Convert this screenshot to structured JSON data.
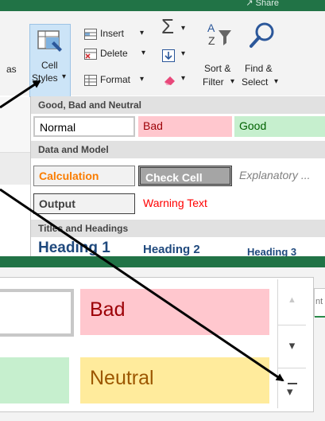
{
  "title_bar": {
    "share_text": "↗ Share"
  },
  "ribbon": {
    "left_cut_label": "as",
    "cell_styles": {
      "line1": "Cell",
      "line2": "Styles",
      "dropdown": "▾"
    },
    "insert_label": "Insert",
    "delete_label": "Delete",
    "format_label": "Format",
    "sort_filter": {
      "line1": "Sort &",
      "line2": "Filter"
    },
    "find_select": {
      "line1": "Find &",
      "line2": "Select"
    },
    "dropdown_arrow": "▾"
  },
  "gallery": {
    "sections": [
      {
        "header": "Good, Bad and Neutral",
        "styles": [
          {
            "label": "Normal",
            "fg": "#000000",
            "bg": "#ffffff"
          },
          {
            "label": "Bad",
            "fg": "#9c0006",
            "bg": "#ffc7ce"
          },
          {
            "label": "Good",
            "fg": "#006100",
            "bg": "#c6efce"
          }
        ]
      },
      {
        "header": "Data and Model",
        "styles": [
          {
            "label": "Calculation",
            "fg": "#fa7d00",
            "bg": "#f2f2f2"
          },
          {
            "label": "Check Cell",
            "fg": "#ffffff",
            "bg": "#a5a5a5"
          },
          {
            "label": "Explanatory ...",
            "fg": "#7f7f7f",
            "bg": "#ffffff"
          }
        ]
      },
      {
        "header": "",
        "styles": [
          {
            "label": "Output",
            "fg": "#3f3f3f",
            "bg": "#f2f2f2"
          },
          {
            "label": "Warning Text",
            "fg": "#ff0000",
            "bg": "#ffffff"
          }
        ]
      },
      {
        "header": "Titles and Headings",
        "styles": [
          {
            "label": "Heading 1",
            "fg": "#1f497d"
          },
          {
            "label": "Heading 2",
            "fg": "#1f497d"
          },
          {
            "label": "Heading 3",
            "fg": "#1f497d"
          }
        ]
      }
    ]
  },
  "zoomed_gallery": {
    "side_text": "nt",
    "styles": [
      {
        "label": "",
        "bg": "#ffffff"
      },
      {
        "label": "Bad",
        "fg": "#9c0006",
        "bg": "#ffc7ce"
      },
      {
        "label": "",
        "bg": "#c6efce"
      },
      {
        "label": "Neutral",
        "fg": "#9c5700",
        "bg": "#ffeb9c"
      }
    ],
    "scroll_up": "▲",
    "scroll_down": "▾",
    "more_button": "▾"
  },
  "colors": {
    "excel_green": "#217346",
    "arrow": "#000000",
    "selection_blue": "#cce4f7"
  }
}
